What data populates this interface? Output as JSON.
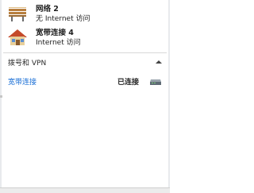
{
  "networks": [
    {
      "name": "网络 2",
      "status": "无 Internet 访问",
      "icon": "bench-network-icon"
    },
    {
      "name": "宽带连接 4",
      "status": "Internet 访问",
      "icon": "house-network-icon"
    }
  ],
  "section": {
    "title": "拨号和 VPN",
    "items": [
      {
        "name": "宽带连接",
        "status": "已连接",
        "icon": "modem-icon"
      }
    ]
  },
  "colors": {
    "link": "#1a6fd6",
    "divider": "#d8d8d8"
  }
}
